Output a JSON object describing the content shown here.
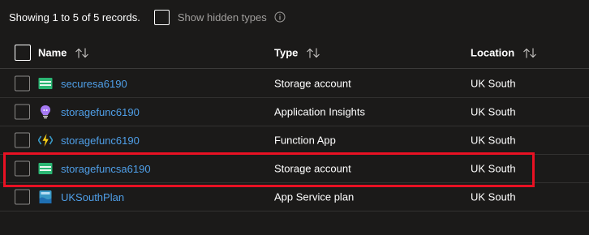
{
  "summary": {
    "records_text": "Showing 1 to 5 of 5 records.",
    "show_hidden_label": "Show hidden types"
  },
  "columns": {
    "name": "Name",
    "type": "Type",
    "location": "Location"
  },
  "rows": [
    {
      "name": "securesa6190",
      "type": "Storage account",
      "location": "UK South",
      "icon": "storage-account-icon"
    },
    {
      "name": "storagefunc6190",
      "type": "Application Insights",
      "location": "UK South",
      "icon": "app-insights-icon"
    },
    {
      "name": "storagefunc6190",
      "type": "Function App",
      "location": "UK South",
      "icon": "function-app-icon"
    },
    {
      "name": "storagefuncsa6190",
      "type": "Storage account",
      "location": "UK South",
      "icon": "storage-account-icon"
    },
    {
      "name": "UKSouthPlan",
      "type": "App Service plan",
      "location": "UK South",
      "icon": "app-service-plan-icon"
    }
  ],
  "highlighted_row": 4,
  "colors": {
    "background": "#1b1a19",
    "link": "#4f9fe8",
    "highlight_border": "#e81123"
  }
}
